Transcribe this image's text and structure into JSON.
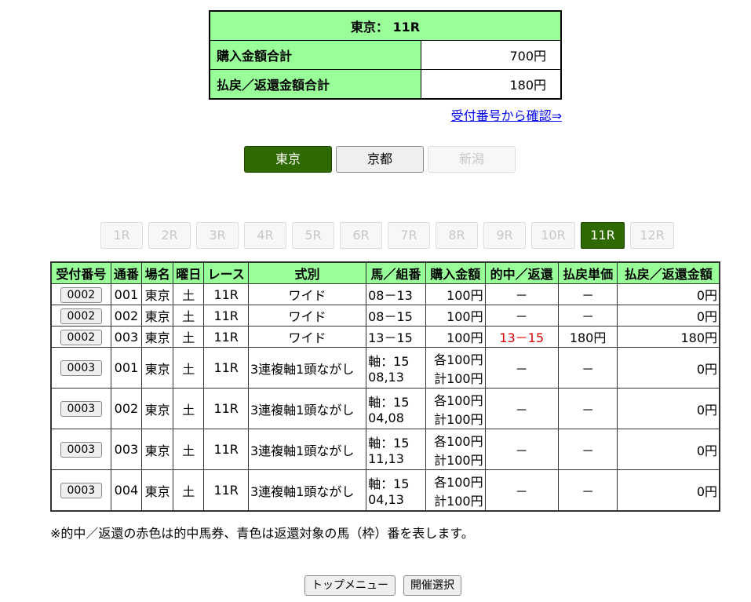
{
  "summary": {
    "header": "東京： 11R",
    "rows": [
      {
        "label": "購入金額合計",
        "value": "700円"
      },
      {
        "label": "払戻／返還金額合計",
        "value": "180円"
      }
    ],
    "confirm_link": "受付番号から確認⇒"
  },
  "venues": [
    {
      "label": "東京",
      "state": "active"
    },
    {
      "label": "京都",
      "state": "normal"
    },
    {
      "label": "新潟",
      "state": "disabled"
    }
  ],
  "races": [
    "1R",
    "2R",
    "3R",
    "4R",
    "5R",
    "6R",
    "7R",
    "8R",
    "9R",
    "10R",
    "11R",
    "12R"
  ],
  "active_race": "11R",
  "table": {
    "headers": [
      "受付番号",
      "通番",
      "場名",
      "曜日",
      "レース",
      "式別",
      "馬／組番",
      "購入金額",
      "的中／返還",
      "払戻単価",
      "払戻／返還金額"
    ],
    "rows": [
      {
        "receipt": "0002",
        "seq": "001",
        "venue": "東京",
        "day": "土",
        "race": "11R",
        "type": "ワイド",
        "combo": [
          "08－13"
        ],
        "amount": [
          "100円"
        ],
        "hit": "－",
        "hit_flag": false,
        "unit": "－",
        "payout": "0円"
      },
      {
        "receipt": "0002",
        "seq": "002",
        "venue": "東京",
        "day": "土",
        "race": "11R",
        "type": "ワイド",
        "combo": [
          "08－15"
        ],
        "amount": [
          "100円"
        ],
        "hit": "－",
        "hit_flag": false,
        "unit": "－",
        "payout": "0円"
      },
      {
        "receipt": "0002",
        "seq": "003",
        "venue": "東京",
        "day": "土",
        "race": "11R",
        "type": "ワイド",
        "combo": [
          "13－15"
        ],
        "amount": [
          "100円"
        ],
        "hit": "13－15",
        "hit_flag": true,
        "unit": "180円",
        "payout": "180円"
      },
      {
        "receipt": "0003",
        "seq": "001",
        "venue": "東京",
        "day": "土",
        "race": "11R",
        "type": "3連複軸1頭ながし",
        "combo": [
          "軸：15",
          "08,13"
        ],
        "amount": [
          "各100円",
          "計100円"
        ],
        "hit": "－",
        "hit_flag": false,
        "unit": "－",
        "payout": "0円"
      },
      {
        "receipt": "0003",
        "seq": "002",
        "venue": "東京",
        "day": "土",
        "race": "11R",
        "type": "3連複軸1頭ながし",
        "combo": [
          "軸：15",
          "04,08"
        ],
        "amount": [
          "各100円",
          "計100円"
        ],
        "hit": "－",
        "hit_flag": false,
        "unit": "－",
        "payout": "0円"
      },
      {
        "receipt": "0003",
        "seq": "003",
        "venue": "東京",
        "day": "土",
        "race": "11R",
        "type": "3連複軸1頭ながし",
        "combo": [
          "軸：15",
          "11,13"
        ],
        "amount": [
          "各100円",
          "計100円"
        ],
        "hit": "－",
        "hit_flag": false,
        "unit": "－",
        "payout": "0円"
      },
      {
        "receipt": "0003",
        "seq": "004",
        "venue": "東京",
        "day": "土",
        "race": "11R",
        "type": "3連複軸1頭ながし",
        "combo": [
          "軸：15",
          "04,13"
        ],
        "amount": [
          "各100円",
          "計100円"
        ],
        "hit": "－",
        "hit_flag": false,
        "unit": "－",
        "payout": "0円"
      }
    ]
  },
  "note": "※的中／返還の赤色は的中馬券、青色は返還対象の馬（枠）番を表します。",
  "buttons": {
    "top_menu": "トップメニュー",
    "venue_select": "開催選択"
  },
  "colors": {
    "header_bg": "#99ff99",
    "active_bg": "#2e6a00",
    "hit": "#e00000",
    "link": "#0000ee"
  }
}
